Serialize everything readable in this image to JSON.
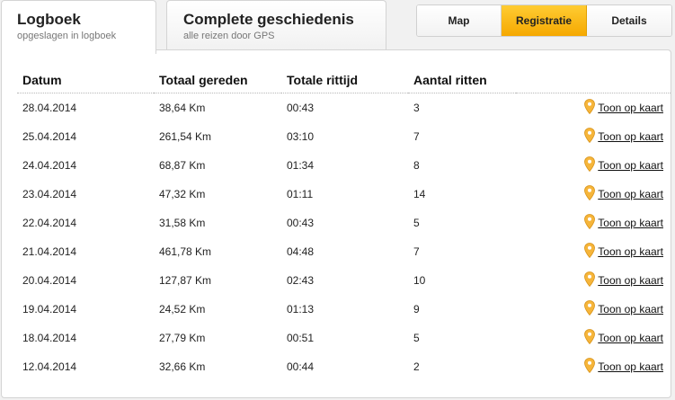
{
  "tabs": [
    {
      "title": "Logboek",
      "subtitle": "opgeslagen in logboek"
    },
    {
      "title": "Complete geschiedenis",
      "subtitle": "alle reizen door GPS"
    }
  ],
  "view_buttons": [
    "Map",
    "Registratie",
    "Details"
  ],
  "view_active": "Registratie",
  "colors": {
    "accent": "#f5a800",
    "pin": "#f6b53a"
  },
  "table": {
    "headers": [
      "Datum",
      "Totaal gereden",
      "Totale rittijd",
      "Aantal ritten"
    ],
    "map_link_label": "Toon op kaart",
    "map_link_icon": "map-pin-icon",
    "rows": [
      {
        "date": "28.04.2014",
        "distance": "38,64 Km",
        "time": "00:43",
        "trips": "3"
      },
      {
        "date": "25.04.2014",
        "distance": "261,54 Km",
        "time": "03:10",
        "trips": "7"
      },
      {
        "date": "24.04.2014",
        "distance": "68,87 Km",
        "time": "01:34",
        "trips": "8"
      },
      {
        "date": "23.04.2014",
        "distance": "47,32 Km",
        "time": "01:11",
        "trips": "14"
      },
      {
        "date": "22.04.2014",
        "distance": "31,58 Km",
        "time": "00:43",
        "trips": "5"
      },
      {
        "date": "21.04.2014",
        "distance": "461,78 Km",
        "time": "04:48",
        "trips": "7"
      },
      {
        "date": "20.04.2014",
        "distance": "127,87 Km",
        "time": "02:43",
        "trips": "10"
      },
      {
        "date": "19.04.2014",
        "distance": "24,52 Km",
        "time": "01:13",
        "trips": "9"
      },
      {
        "date": "18.04.2014",
        "distance": "27,79 Km",
        "time": "00:51",
        "trips": "5"
      },
      {
        "date": "12.04.2014",
        "distance": "32,66 Km",
        "time": "00:44",
        "trips": "2"
      }
    ]
  }
}
